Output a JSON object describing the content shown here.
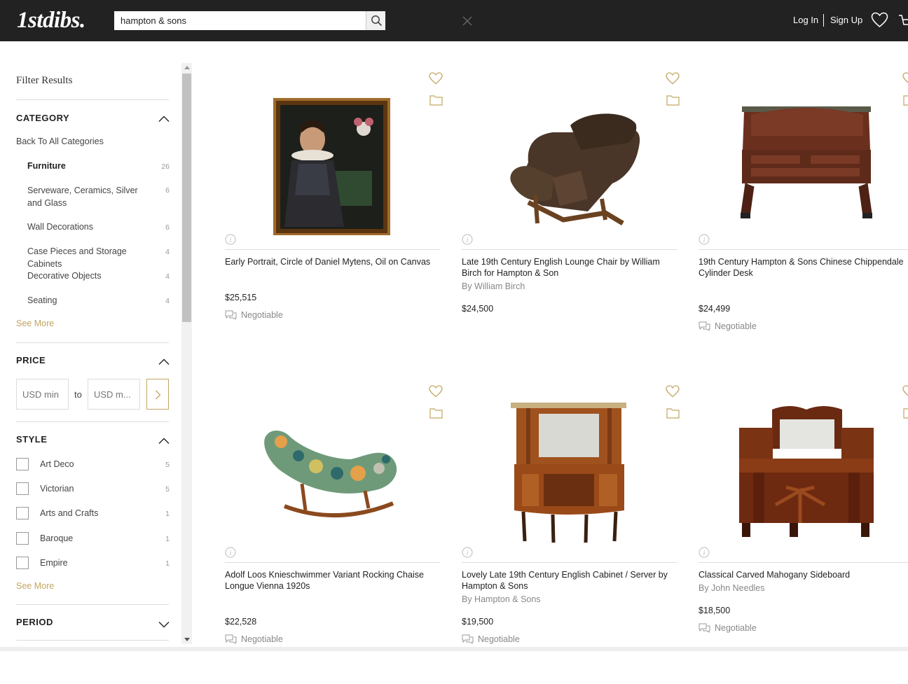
{
  "header": {
    "logo": "1stdibs.",
    "search_value": "hampton & sons",
    "login": "Log In",
    "signup": "Sign Up"
  },
  "sidebar": {
    "title": "Filter Results",
    "category": {
      "title": "CATEGORY",
      "back": "Back To All Categories",
      "items": [
        {
          "label": "Furniture",
          "count": "26"
        },
        {
          "label": "Serveware, Ceramics, Silver and Glass",
          "count": "6"
        },
        {
          "label": "Wall Decorations",
          "count": "6"
        },
        {
          "label": "Case Pieces and Storage Cabinets",
          "count": "4"
        },
        {
          "label": "Decorative Objects",
          "count": "4"
        },
        {
          "label": "Seating",
          "count": "4"
        }
      ],
      "see_more": "See More"
    },
    "price": {
      "title": "PRICE",
      "min_placeholder": "USD min",
      "max_placeholder": "USD m...",
      "to": "to"
    },
    "style": {
      "title": "STYLE",
      "items": [
        {
          "label": "Art Deco",
          "count": "5"
        },
        {
          "label": "Victorian",
          "count": "5"
        },
        {
          "label": "Arts and Crafts",
          "count": "1"
        },
        {
          "label": "Baroque",
          "count": "1"
        },
        {
          "label": "Empire",
          "count": "1"
        }
      ],
      "see_more": "See More"
    },
    "period": {
      "title": "PERIOD"
    }
  },
  "products": [
    {
      "title": "Early Portrait, Circle of Daniel Mytens, Oil on Canvas",
      "by": "",
      "price": "$25,515",
      "negotiable": "Negotiable"
    },
    {
      "title": "Late 19th Century English Lounge Chair by William Birch for Hampton & Son",
      "by": "By William Birch",
      "price": "$24,500",
      "negotiable": ""
    },
    {
      "title": "19th Century Hampton & Sons Chinese Chippendale Cylinder Desk",
      "by": "",
      "price": "$24,499",
      "negotiable": "Negotiable"
    },
    {
      "title": "Adolf Loos Knieschwimmer Variant Rocking Chaise Longue Vienna 1920s",
      "by": "",
      "price": "$22,528",
      "negotiable": "Negotiable"
    },
    {
      "title": "Lovely Late 19th Century English Cabinet / Server by Hampton & Sons",
      "by": "By Hampton & Sons",
      "price": "$19,500",
      "negotiable": "Negotiable"
    },
    {
      "title": "Classical Carved Mahogany Sideboard",
      "by": "By John Needles",
      "price": "$18,500",
      "negotiable": "Negotiable"
    }
  ],
  "colors": {
    "header_bg": "#222222",
    "accent_gold": "#c2a661"
  }
}
